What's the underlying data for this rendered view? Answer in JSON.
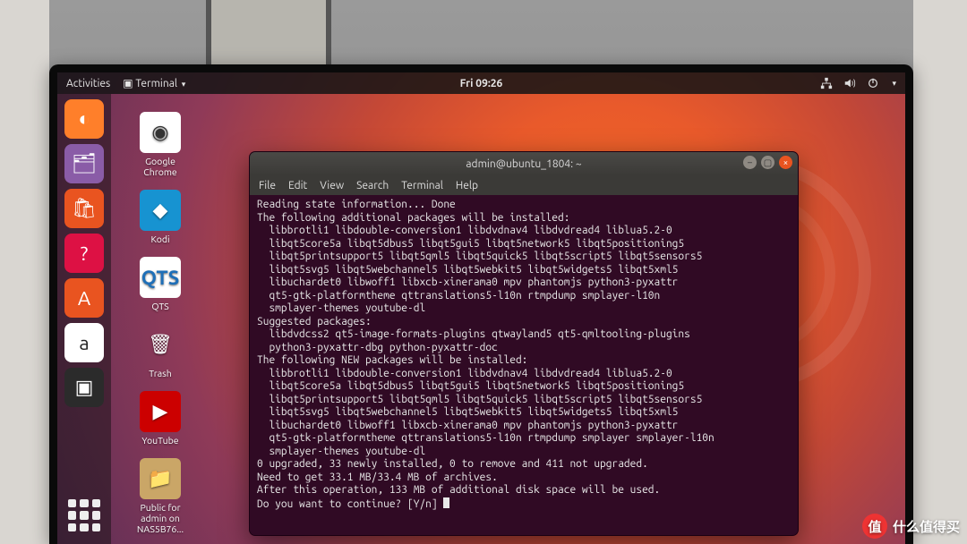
{
  "topbar": {
    "activities": "Activities",
    "app_indicator": "Terminal",
    "clock": "Fri 09:26"
  },
  "desktop_icons": [
    {
      "id": "chrome",
      "label": "Google\nChrome"
    },
    {
      "id": "kodi",
      "label": "Kodi"
    },
    {
      "id": "qts",
      "label": "QTS"
    },
    {
      "id": "trash",
      "label": "Trash"
    },
    {
      "id": "youtube",
      "label": "YouTube"
    },
    {
      "id": "nasfolder",
      "label": "Public for\nadmin on\nNAS5B76..."
    }
  ],
  "terminal": {
    "title": "admin@ubuntu_1804: ~",
    "menu": [
      "File",
      "Edit",
      "View",
      "Search",
      "Terminal",
      "Help"
    ],
    "lines": [
      "Reading state information... Done",
      "The following additional packages will be installed:",
      "  libbrotli1 libdouble-conversion1 libdvdnav4 libdvdread4 liblua5.2-0",
      "  libqt5core5a libqt5dbus5 libqt5gui5 libqt5network5 libqt5positioning5",
      "  libqt5printsupport5 libqt5qml5 libqt5quick5 libqt5script5 libqt5sensors5",
      "  libqt5svg5 libqt5webchannel5 libqt5webkit5 libqt5widgets5 libqt5xml5",
      "  libuchardet0 libwoff1 libxcb-xinerama0 mpv phantomjs python3-pyxattr",
      "  qt5-gtk-platformtheme qttranslations5-l10n rtmpdump smplayer-l10n",
      "  smplayer-themes youtube-dl",
      "Suggested packages:",
      "  libdvdcss2 qt5-image-formats-plugins qtwayland5 qt5-qmltooling-plugins",
      "  python3-pyxattr-dbg python-pyxattr-doc",
      "The following NEW packages will be installed:",
      "  libbrotli1 libdouble-conversion1 libdvdnav4 libdvdread4 liblua5.2-0",
      "  libqt5core5a libqt5dbus5 libqt5gui5 libqt5network5 libqt5positioning5",
      "  libqt5printsupport5 libqt5qml5 libqt5quick5 libqt5script5 libqt5sensors5",
      "  libqt5svg5 libqt5webchannel5 libqt5webkit5 libqt5widgets5 libqt5xml5",
      "  libuchardet0 libwoff1 libxcb-xinerama0 mpv phantomjs python3-pyxattr",
      "  qt5-gtk-platformtheme qttranslations5-l10n rtmpdump smplayer smplayer-l10n",
      "  smplayer-themes youtube-dl",
      "0 upgraded, 33 newly installed, 0 to remove and 411 not upgraded.",
      "Need to get 33.1 MB/33.4 MB of archives.",
      "After this operation, 133 MB of additional disk space will be used.",
      "Do you want to continue? [Y/n] "
    ]
  },
  "watermark": "什么值得买"
}
